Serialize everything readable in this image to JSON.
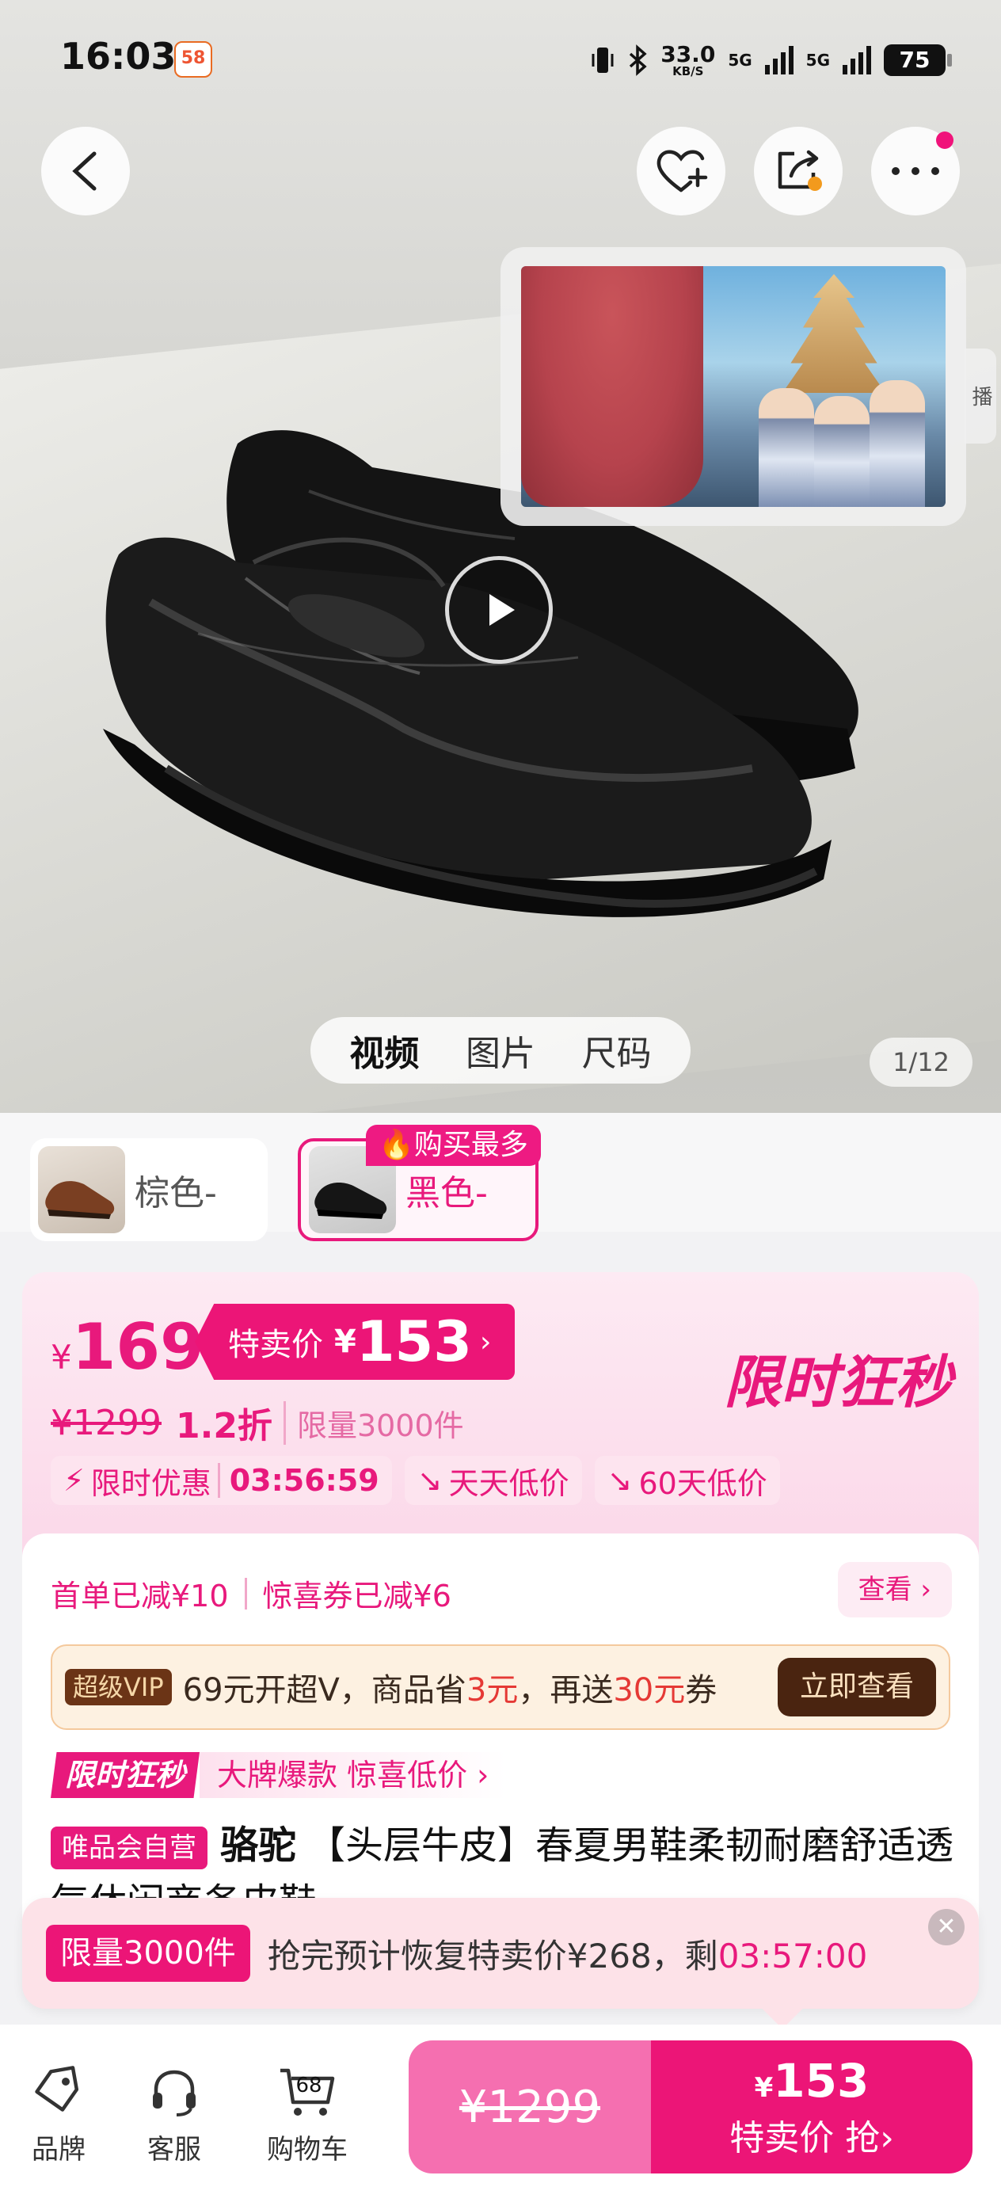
{
  "status": {
    "time": "16:03",
    "app_badge": "58",
    "net_speed": "33.0",
    "net_unit": "KB/S",
    "net_5g_1": "5G",
    "net_5g_2": "5G",
    "battery": "75"
  },
  "media": {
    "tabs": [
      "视频",
      "图片",
      "尺码"
    ],
    "active_tab": "视频",
    "pager": "1/12",
    "pip_side_text": "播"
  },
  "colors": {
    "options": [
      {
        "label": "棕色-"
      },
      {
        "label": "黑色-",
        "selected": true
      }
    ],
    "hot_badge": "购买最多"
  },
  "price": {
    "currency": "¥",
    "current": "169",
    "special_label": "特卖价",
    "special_value": "153",
    "original": "¥1299",
    "discount": "1.2折",
    "limit": "限量3000件",
    "flash_title": "限时狂秒",
    "chips": {
      "limited_label": "限时优惠",
      "countdown": "03:56:59",
      "daily_low": "天天低价",
      "sixty_low": "60天低价"
    }
  },
  "info": {
    "coupon_first": "首单已减¥10",
    "coupon_surprise": "惊喜券已减¥6",
    "view_label": "查看",
    "vip_badge": "超级VIP",
    "vip_text_a": "69元开超V，商品省",
    "vip_save": "3元",
    "vip_text_b": "，再送",
    "vip_bonus": "30元",
    "vip_text_c": "券",
    "vip_button": "立即查看",
    "flash_tag": "限时狂秒",
    "flash_slogan": "大牌爆款 惊喜低价 ›",
    "self_run": "唯品会自营",
    "brand": "骆驼",
    "title": "【头层牛皮】春夏男鞋柔韧耐磨舒适透气休闲商务皮鞋"
  },
  "recover": {
    "quota": "限量3000件",
    "message": "抢完预计恢复特卖价¥268，剩",
    "countdown": "03:57:00"
  },
  "bottom": {
    "brand": "品牌",
    "service": "客服",
    "cart": "购物车",
    "cart_count": "68",
    "orig_price": "¥1299",
    "buy_currency": "¥",
    "buy_price": "153",
    "buy_label": "特卖价 抢›"
  },
  "accent": "#e8197c"
}
